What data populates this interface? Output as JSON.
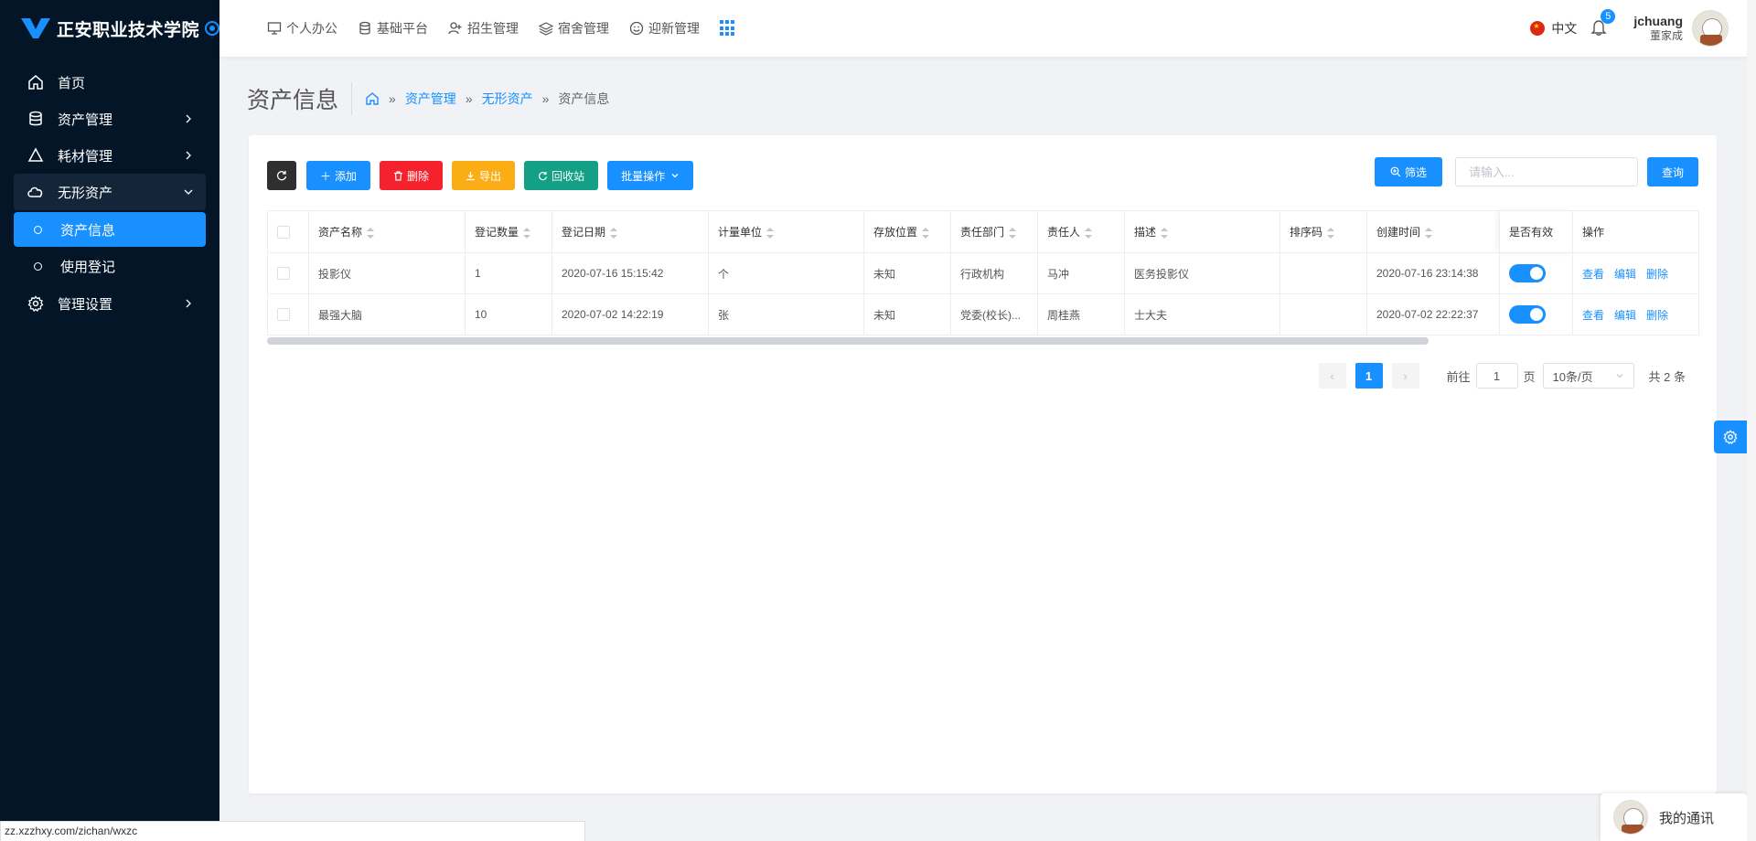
{
  "app": {
    "name": "正安职业技术学院"
  },
  "sidebar": {
    "items": [
      {
        "label": "首页",
        "icon": "home-icon"
      },
      {
        "label": "资产管理",
        "icon": "database-icon"
      },
      {
        "label": "耗材管理",
        "icon": "triangle-icon"
      },
      {
        "label": "无形资产",
        "icon": "cloud-icon"
      },
      {
        "label": "管理设置",
        "icon": "gear-icon"
      }
    ],
    "sub_items": [
      {
        "label": "资产信息",
        "active": true
      },
      {
        "label": "使用登记",
        "active": false
      }
    ]
  },
  "topnav": {
    "items": [
      {
        "label": "个人办公",
        "icon": "monitor-icon"
      },
      {
        "label": "基础平台",
        "icon": "database-icon"
      },
      {
        "label": "招生管理",
        "icon": "user-add-icon"
      },
      {
        "label": "宿舍管理",
        "icon": "layers-icon"
      },
      {
        "label": "迎新管理",
        "icon": "smile-icon"
      }
    ],
    "language": "中文",
    "notifications": "5",
    "username": "jchuang",
    "realname": "董家成"
  },
  "page": {
    "title": "资产信息",
    "breadcrumb": [
      "资产管理",
      "无形资产",
      "资产信息"
    ]
  },
  "toolbar": {
    "add": "添加",
    "delete": "删除",
    "export": "导出",
    "recycle": "回收站",
    "batch": "批量操作",
    "filter": "筛选",
    "search_placeholder": "请输入...",
    "query": "查询"
  },
  "table": {
    "headers": [
      "资产名称",
      "登记数量",
      "登记日期",
      "计量单位",
      "存放位置",
      "责任部门",
      "责任人",
      "描述",
      "排序码",
      "创建时间",
      "是否有效",
      "操作"
    ],
    "rows": [
      {
        "name": "投影仪",
        "qty": "1",
        "date": "2020-07-16 15:15:42",
        "unit": "个",
        "location": "未知",
        "dept": "行政机构",
        "person": "马冲",
        "desc": "医务投影仪",
        "sort": "",
        "created": "2020-07-16 23:14:38",
        "valid": true
      },
      {
        "name": "最强大脑",
        "qty": "10",
        "date": "2020-07-02 14:22:19",
        "unit": "张",
        "location": "未知",
        "dept": "党委(校长)...",
        "person": "周桂燕",
        "desc": "士大夫",
        "sort": "",
        "created": "2020-07-02 22:22:37",
        "valid": true
      }
    ],
    "actions": {
      "view": "查看",
      "edit": "编辑",
      "delete": "删除"
    }
  },
  "pagination": {
    "current": "1",
    "goto_label": "前往",
    "goto_value": "1",
    "page_unit": "页",
    "page_size": "10条/页",
    "total": "共 2 条"
  },
  "chat": {
    "label": "我的通讯"
  },
  "statusbar": {
    "url": "zz.xzzhxy.com/zichan/wxzc"
  },
  "colors": {
    "primary": "#1890ff",
    "sidebar": "#031527",
    "danger": "#f5222d",
    "warning": "#faad14",
    "success": "#13a086"
  }
}
